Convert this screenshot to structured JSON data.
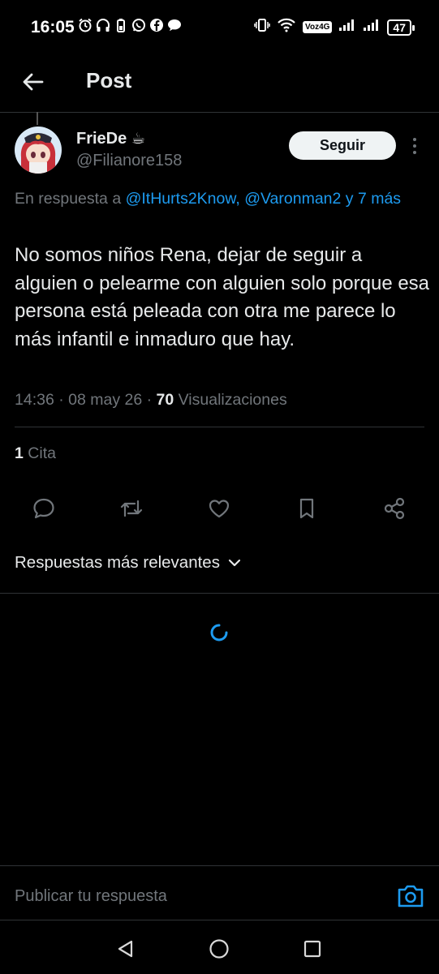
{
  "status_bar": {
    "time": "16:05",
    "network_label": "Voz4G",
    "battery": "47",
    "icons": [
      "alarm-icon",
      "headphones-icon",
      "battery-saver-icon",
      "whatsapp-icon",
      "facebook-icon",
      "chat-icon",
      "vibrate-icon",
      "wifi-icon",
      "signal-icon"
    ]
  },
  "header": {
    "title": "Post"
  },
  "post": {
    "author_name": "FrieDe",
    "author_emoji": "☕",
    "author_handle": "@Filianore158",
    "follow_label": "Seguir",
    "reply_prefix": "En respuesta a",
    "reply_mentions": "@ItHurts2Know, @Varonman2 y 7 más",
    "text": "No somos niños Rena, dejar de seguir a alguien o pelearme con alguien solo porque esa persona está peleada con otra me parece lo más infantil e inmaduro que hay.",
    "timestamp": "14:36 · 08 may 26 · ",
    "views_count": "70",
    "views_label": " Visualizaciones"
  },
  "quotes": {
    "count": "1",
    "label": " Cita"
  },
  "actions": [
    "reply-icon",
    "repost-icon",
    "like-icon",
    "bookmark-icon",
    "share-icon"
  ],
  "replies": {
    "sort_label": "Respuestas más relevantes"
  },
  "composer": {
    "placeholder": "Publicar tu respuesta"
  },
  "colors": {
    "background": "#000000",
    "text": "#e7e9ea",
    "secondary": "#71767b",
    "accent": "#1d9bf0",
    "divider": "#2f3336"
  }
}
